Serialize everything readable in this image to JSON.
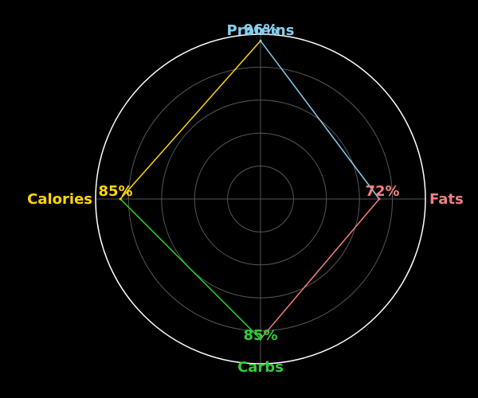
{
  "chart_data": {
    "type": "radar",
    "categories": [
      "Proteins",
      "Fats",
      "Carbs",
      "Calories"
    ],
    "values": [
      96,
      72,
      85,
      85
    ],
    "value_labels": [
      "96%",
      "72%",
      "85%",
      "85%"
    ],
    "category_colors": [
      "#87ceeb",
      "#f08080",
      "#32cd32",
      "#ffd700"
    ],
    "rlim": [
      0,
      100
    ],
    "grid": true,
    "background": "#000000",
    "grid_color": "#555555",
    "outer_ring_color": "#ffffff"
  }
}
